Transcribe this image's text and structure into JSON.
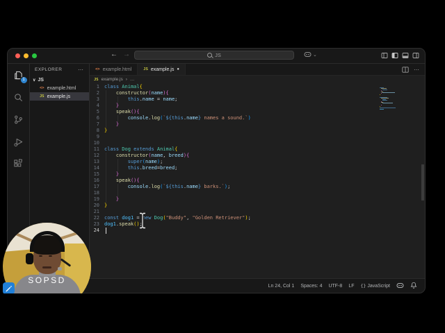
{
  "titlebar": {
    "traffic_lights": [
      {
        "name": "close",
        "color": "#ff5f57"
      },
      {
        "name": "minimize",
        "color": "#febc2e"
      },
      {
        "name": "zoom",
        "color": "#28c840"
      }
    ],
    "back_arrow": "←",
    "forward_arrow": "→",
    "command_center": {
      "text": "JS"
    },
    "copilot_chevron": "⌄",
    "layout_icons": [
      "toggle-primary-sidebar",
      "panel-left",
      "panel-bottom",
      "panel-right"
    ]
  },
  "activity_bar": {
    "items": [
      {
        "icon": "explorer",
        "badge": "1",
        "active": true
      },
      {
        "icon": "search",
        "active": false
      },
      {
        "icon": "source-control",
        "active": false
      },
      {
        "icon": "run-debug",
        "active": false
      },
      {
        "icon": "extensions",
        "active": false
      }
    ]
  },
  "explorer": {
    "title": "EXPLORER",
    "more": "⋯",
    "workspace": {
      "chevron": "∨",
      "name": "JS"
    },
    "files": [
      {
        "icon": "html",
        "label": "example.html",
        "selected": false
      },
      {
        "icon": "js",
        "label": "example.js",
        "selected": true
      }
    ]
  },
  "tabs": [
    {
      "icon": "html",
      "label": "example.html",
      "active": false,
      "modified": false
    },
    {
      "icon": "js",
      "label": "example.js",
      "active": true,
      "modified": true
    }
  ],
  "tab_actions": {
    "more": "⋯"
  },
  "breadcrumb": {
    "icon": "JS",
    "file": "example.js",
    "separator": "›",
    "more": "…"
  },
  "editor": {
    "caret_line": 24,
    "caret_col": 1,
    "palette": {
      "kw": "#569cd6",
      "cls": "#4ec9b0",
      "fn": "#dcdcaa",
      "var": "#9cdcfe",
      "cvar": "#4fc1ff",
      "str": "#ce9178",
      "b1": "#ffd700",
      "b2": "#da70d6",
      "b3": "#179fff",
      "pl": "#d4d4d4",
      "tpl": "#569cd6"
    },
    "lines": [
      {
        "n": 1,
        "indent": 0,
        "segs": [
          [
            "kw",
            "class "
          ],
          [
            "cls",
            "Animal"
          ],
          [
            "b1",
            "{"
          ]
        ]
      },
      {
        "n": 2,
        "indent": 4,
        "segs": [
          [
            "pl",
            "    "
          ],
          [
            "fn",
            "constructor"
          ],
          [
            "b2",
            "("
          ],
          [
            "var",
            "name"
          ],
          [
            "b2",
            "){"
          ]
        ]
      },
      {
        "n": 3,
        "indent": 8,
        "segs": [
          [
            "pl",
            "        "
          ],
          [
            "kw",
            "this"
          ],
          [
            "pl",
            "."
          ],
          [
            "var",
            "name"
          ],
          [
            "pl",
            " = "
          ],
          [
            "var",
            "name"
          ],
          [
            "pl",
            ";"
          ]
        ]
      },
      {
        "n": 4,
        "indent": 4,
        "segs": [
          [
            "pl",
            "    "
          ],
          [
            "b2",
            "}"
          ]
        ]
      },
      {
        "n": 5,
        "indent": 4,
        "segs": [
          [
            "pl",
            "    "
          ],
          [
            "fn",
            "speak"
          ],
          [
            "b2",
            "(){"
          ]
        ]
      },
      {
        "n": 6,
        "indent": 8,
        "segs": [
          [
            "pl",
            "        "
          ],
          [
            "var",
            "console"
          ],
          [
            "pl",
            "."
          ],
          [
            "fn",
            "log"
          ],
          [
            "b3",
            "("
          ],
          [
            "str",
            "`"
          ],
          [
            "tpl",
            "${"
          ],
          [
            "kw",
            "this"
          ],
          [
            "pl",
            "."
          ],
          [
            "var",
            "name"
          ],
          [
            "tpl",
            "}"
          ],
          [
            "str",
            " names a sound.`"
          ],
          [
            "b3",
            ")"
          ]
        ]
      },
      {
        "n": 7,
        "indent": 4,
        "segs": [
          [
            "pl",
            "    "
          ],
          [
            "b2",
            "}"
          ]
        ]
      },
      {
        "n": 8,
        "indent": 0,
        "segs": [
          [
            "b1",
            "}"
          ]
        ]
      },
      {
        "n": 9,
        "indent": 0,
        "segs": []
      },
      {
        "n": 10,
        "indent": 0,
        "segs": []
      },
      {
        "n": 11,
        "indent": 0,
        "segs": [
          [
            "kw",
            "class "
          ],
          [
            "cls",
            "Dog "
          ],
          [
            "kw",
            "extends "
          ],
          [
            "cls",
            "Animal"
          ],
          [
            "b1",
            "{"
          ]
        ]
      },
      {
        "n": 12,
        "indent": 4,
        "segs": [
          [
            "pl",
            "    "
          ],
          [
            "fn",
            "constructor"
          ],
          [
            "b2",
            "("
          ],
          [
            "var",
            "name"
          ],
          [
            "pl",
            ", "
          ],
          [
            "var",
            "breed"
          ],
          [
            "b2",
            "){"
          ]
        ]
      },
      {
        "n": 13,
        "indent": 8,
        "segs": [
          [
            "pl",
            "        "
          ],
          [
            "kw",
            "super"
          ],
          [
            "b3",
            "("
          ],
          [
            "var",
            "name"
          ],
          [
            "b3",
            ")"
          ],
          [
            "pl",
            ";"
          ]
        ]
      },
      {
        "n": 14,
        "indent": 8,
        "segs": [
          [
            "pl",
            "        "
          ],
          [
            "kw",
            "this"
          ],
          [
            "pl",
            "."
          ],
          [
            "var",
            "breed"
          ],
          [
            "pl",
            "="
          ],
          [
            "var",
            "breed"
          ],
          [
            "pl",
            ";"
          ]
        ]
      },
      {
        "n": 15,
        "indent": 4,
        "segs": [
          [
            "pl",
            "    "
          ],
          [
            "b2",
            "}"
          ]
        ]
      },
      {
        "n": 16,
        "indent": 4,
        "segs": [
          [
            "pl",
            "    "
          ],
          [
            "fn",
            "speak"
          ],
          [
            "b2",
            "(){"
          ]
        ]
      },
      {
        "n": 17,
        "indent": 8,
        "segs": [
          [
            "pl",
            "        "
          ],
          [
            "var",
            "console"
          ],
          [
            "pl",
            "."
          ],
          [
            "fn",
            "log"
          ],
          [
            "b3",
            "("
          ],
          [
            "str",
            "`"
          ],
          [
            "tpl",
            "${"
          ],
          [
            "kw",
            "this"
          ],
          [
            "pl",
            "."
          ],
          [
            "var",
            "name"
          ],
          [
            "tpl",
            "}"
          ],
          [
            "str",
            " barks.`"
          ],
          [
            "b3",
            ")"
          ],
          [
            "pl",
            ";"
          ]
        ]
      },
      {
        "n": 18,
        "indent": 8,
        "segs": []
      },
      {
        "n": 19,
        "indent": 4,
        "segs": [
          [
            "pl",
            "    "
          ],
          [
            "b2",
            "}"
          ]
        ]
      },
      {
        "n": 20,
        "indent": 0,
        "segs": [
          [
            "b1",
            "}"
          ]
        ]
      },
      {
        "n": 21,
        "indent": 0,
        "segs": []
      },
      {
        "n": 22,
        "indent": 0,
        "segs": [
          [
            "kw",
            "const "
          ],
          [
            "cvar",
            "dog1 "
          ],
          [
            "pl",
            "= "
          ],
          [
            "kw",
            "new "
          ],
          [
            "cls",
            "Dog"
          ],
          [
            "b1",
            "("
          ],
          [
            "str",
            "\"Buddy\""
          ],
          [
            "pl",
            ", "
          ],
          [
            "str",
            "\"Golden Retriever\""
          ],
          [
            "b1",
            ")"
          ],
          [
            "pl",
            ";"
          ]
        ]
      },
      {
        "n": 23,
        "indent": 0,
        "segs": [
          [
            "cvar",
            "dog1"
          ],
          [
            "pl",
            "."
          ],
          [
            "fn",
            "speak"
          ],
          [
            "b1",
            "()"
          ],
          [
            "pl",
            ";"
          ]
        ]
      },
      {
        "n": 24,
        "indent": 0,
        "segs": []
      }
    ]
  },
  "status_bar": {
    "items": [
      {
        "label": "Ln 24, Col 1"
      },
      {
        "label": "Spaces: 4"
      },
      {
        "label": "UTF-8"
      },
      {
        "label": "LF"
      },
      {
        "icon": "braces",
        "label": "JavaScript"
      },
      {
        "icon": "copilot",
        "label": ""
      },
      {
        "icon": "bell",
        "label": ""
      }
    ]
  },
  "overlay": {
    "webcam_label": "SOPSD"
  }
}
